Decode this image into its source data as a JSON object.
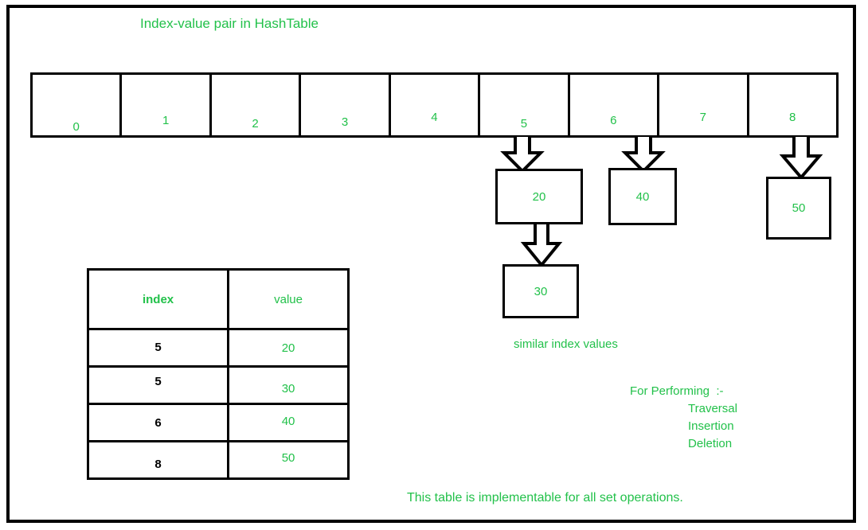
{
  "meta": {
    "title": "Index-value pair in HashTable",
    "accent_color": "#22c14a",
    "line_color": "#000000",
    "background": "#ffffff"
  },
  "hash_array": {
    "label": "hash-table-slot-array",
    "cells": [
      {
        "index": "0"
      },
      {
        "index": "1"
      },
      {
        "index": "2"
      },
      {
        "index": "3"
      },
      {
        "index": "4"
      },
      {
        "index": "5"
      },
      {
        "index": "6"
      },
      {
        "index": "7"
      },
      {
        "index": "8"
      }
    ]
  },
  "value_boxes": [
    {
      "id": "box-20",
      "value": "20",
      "from_index": "5"
    },
    {
      "id": "box-40",
      "value": "40",
      "from_index": "6"
    },
    {
      "id": "box-50",
      "value": "50",
      "from_index": "8"
    },
    {
      "id": "box-30",
      "value": "30",
      "from_index": "5"
    }
  ],
  "arrows": [
    {
      "id": "arrow-slot5-to-20",
      "direction": "down"
    },
    {
      "id": "arrow-slot6-to-40",
      "direction": "down"
    },
    {
      "id": "arrow-slot8-to-50",
      "direction": "down"
    },
    {
      "id": "arrow-20-to-30",
      "direction": "down"
    }
  ],
  "kv_table": {
    "headers": {
      "key": "index",
      "value": "value"
    },
    "rows": [
      {
        "index": "5",
        "value": "20"
      },
      {
        "index": "5",
        "value": "30"
      },
      {
        "index": "6",
        "value": "40"
      },
      {
        "index": "8",
        "value": "50"
      }
    ]
  },
  "notes": {
    "similar_index": "similar index values",
    "operations_title": "For Performing  :-",
    "operations": [
      "Traversal",
      "Insertion",
      "Deletion"
    ],
    "footer": "This table is implementable for all set operations."
  },
  "chart_data": {
    "type": "table",
    "title": "Index-value pair in HashTable",
    "columns": [
      "index",
      "value"
    ],
    "rows": [
      [
        "5",
        "20"
      ],
      [
        "5",
        "30"
      ],
      [
        "6",
        "40"
      ],
      [
        "8",
        "50"
      ]
    ],
    "slots": [
      "0",
      "1",
      "2",
      "3",
      "4",
      "5",
      "6",
      "7",
      "8"
    ],
    "slot_contents": {
      "5": [
        "20",
        "30"
      ],
      "6": [
        "40"
      ],
      "8": [
        "50"
      ]
    },
    "annotations": [
      "similar index values",
      "For Performing  :-",
      "Traversal",
      "Insertion",
      "Deletion",
      "This table is implementable for all set operations."
    ]
  }
}
